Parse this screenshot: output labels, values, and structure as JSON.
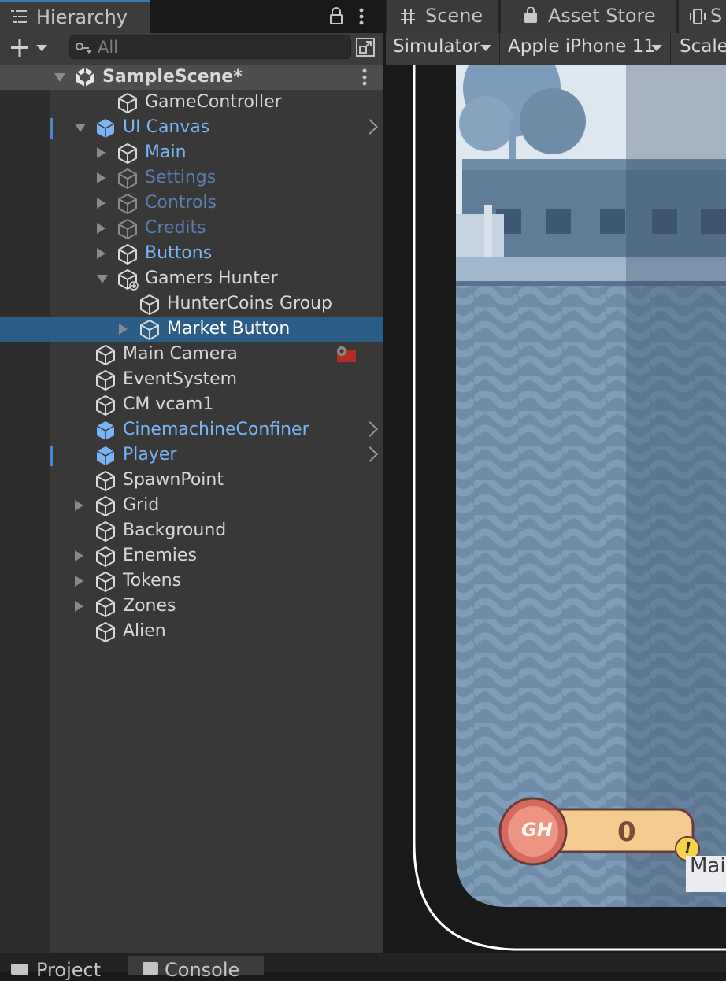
{
  "hierarchy": {
    "tab_label": "Hierarchy",
    "search_placeholder": "All",
    "scene_name": "SampleScene*",
    "items": [
      {
        "label": "GameController"
      },
      {
        "label": "UI Canvas"
      },
      {
        "label": "Main"
      },
      {
        "label": "Settings"
      },
      {
        "label": "Controls"
      },
      {
        "label": "Credits"
      },
      {
        "label": "Buttons"
      },
      {
        "label": "Gamers Hunter"
      },
      {
        "label": "HunterCoins Group"
      },
      {
        "label": "Market Button"
      },
      {
        "label": "Main Camera"
      },
      {
        "label": "EventSystem"
      },
      {
        "label": "CM vcam1"
      },
      {
        "label": "CinemachineConfiner"
      },
      {
        "label": "Player"
      },
      {
        "label": "SpawnPoint"
      },
      {
        "label": "Grid"
      },
      {
        "label": "Background"
      },
      {
        "label": "Enemies"
      },
      {
        "label": "Tokens"
      },
      {
        "label": "Zones"
      },
      {
        "label": "Alien"
      }
    ]
  },
  "scene": {
    "tabs": [
      {
        "label": "Scene"
      },
      {
        "label": "Asset Store"
      },
      {
        "label": "S"
      }
    ],
    "mode_dropdown": "Simulator",
    "device_dropdown": "Apple iPhone 11",
    "scale_label": "Scale",
    "coin_counter": "0",
    "coin_logo_text": "GH",
    "warning_glyph": "!",
    "partial_button_text": "Mai"
  },
  "bottom_tabs": [
    {
      "label": "Project"
    },
    {
      "label": "Console"
    }
  ],
  "colors": {
    "selection": "#2c5d87",
    "prefab_blue": "#7ab4f5",
    "panel_bg": "#383838"
  }
}
